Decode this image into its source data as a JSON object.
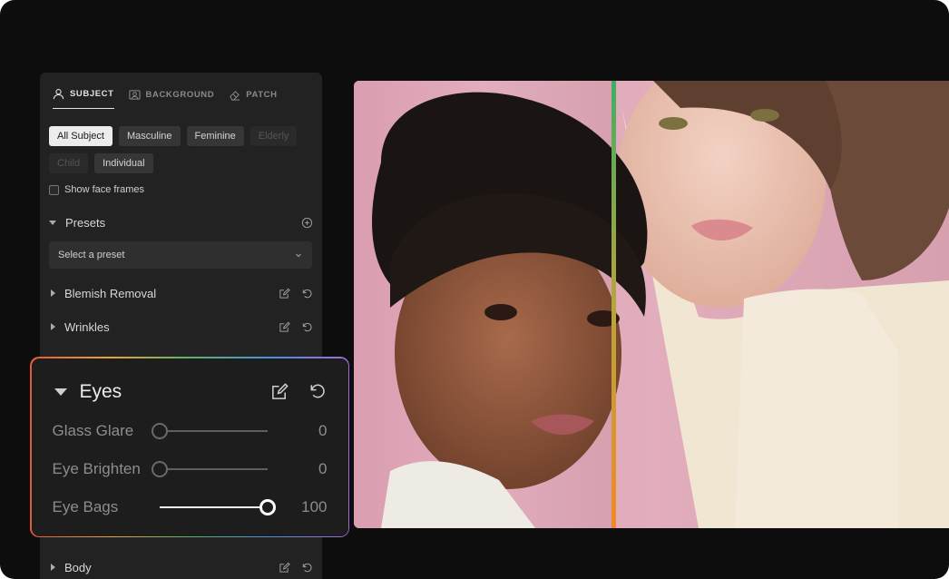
{
  "tabs": [
    {
      "label": "SUBJECT",
      "icon": "person-icon",
      "active": true
    },
    {
      "label": "BACKGROUND",
      "icon": "background-icon",
      "active": false
    },
    {
      "label": "PATCH",
      "icon": "eraser-icon",
      "active": false
    }
  ],
  "subject_filters": [
    {
      "label": "All Subject",
      "state": "active"
    },
    {
      "label": "Masculine",
      "state": "normal"
    },
    {
      "label": "Feminine",
      "state": "normal"
    },
    {
      "label": "Elderly",
      "state": "disabled"
    },
    {
      "label": "Child",
      "state": "disabled"
    },
    {
      "label": "Individual",
      "state": "normal"
    }
  ],
  "show_face_frames": {
    "label": "Show face frames",
    "checked": false
  },
  "presets": {
    "label": "Presets",
    "select_placeholder": "Select a preset"
  },
  "sections": {
    "blemish": "Blemish Removal",
    "wrinkles": "Wrinkles",
    "body": "Body"
  },
  "eyes_panel": {
    "title": "Eyes",
    "sliders": [
      {
        "label": "Glass Glare",
        "value": "0",
        "level": 0
      },
      {
        "label": "Eye Brighten",
        "value": "0",
        "level": 0
      },
      {
        "label": "Eye Bags",
        "value": "100",
        "level": 100
      }
    ]
  },
  "colors": {
    "compare_line_top": "#3fae62",
    "compare_line_bottom": "#f08a24",
    "accent_border": [
      "#e25a3a",
      "#e9a43b",
      "#5bb26a",
      "#4d8fe0",
      "#a36ad8"
    ]
  }
}
